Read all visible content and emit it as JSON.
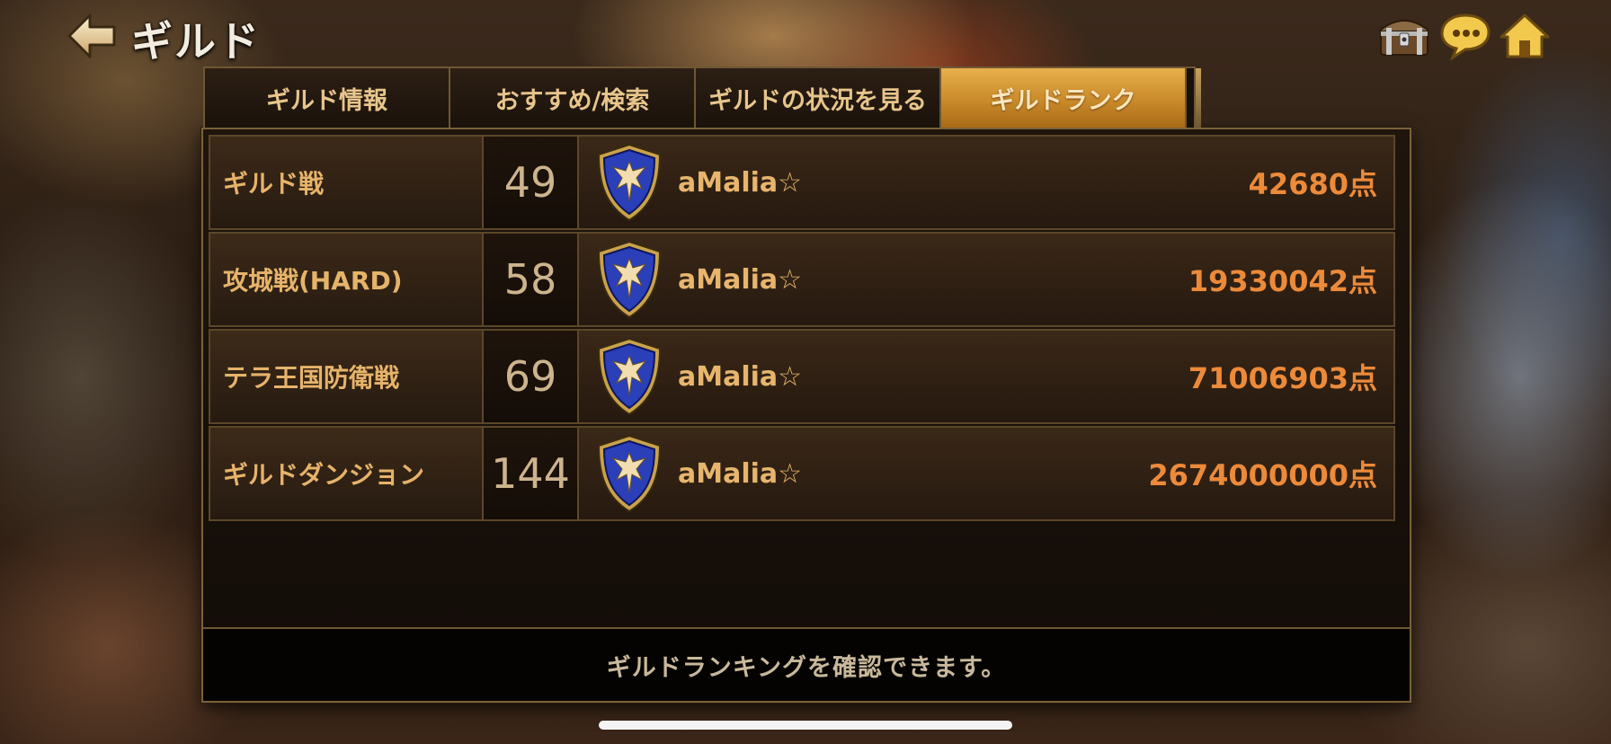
{
  "header": {
    "title": "ギルド"
  },
  "tabs": [
    {
      "label": "ギルド情報",
      "active": false
    },
    {
      "label": "おすすめ/検索",
      "active": false
    },
    {
      "label": "ギルドの状況を見る",
      "active": false
    },
    {
      "label": "ギルドランク",
      "active": true
    }
  ],
  "rankings": [
    {
      "category": "ギルド戦",
      "rank": "49",
      "guild": "aMalia☆",
      "score": "42680点"
    },
    {
      "category": "攻城戦(HARD)",
      "rank": "58",
      "guild": "aMalia☆",
      "score": "19330042点"
    },
    {
      "category": "テラ王国防衛戦",
      "rank": "69",
      "guild": "aMalia☆",
      "score": "71006903点"
    },
    {
      "category": "ギルドダンジョン",
      "rank": "144",
      "guild": "aMalia☆",
      "score": "2674000000点"
    }
  ],
  "info": {
    "message": "ギルドランキングを確認できます。"
  },
  "icons": {
    "back": "back-arrow-icon",
    "chest": "treasure-chest-icon",
    "chat": "chat-bubble-icon",
    "home": "home-icon",
    "emblem": "guild-emblem-icon"
  },
  "colors": {
    "active_tab": "#c98a2a",
    "score": "#ec8a3a",
    "category_text": "#e6b36a",
    "emblem_blue": "#2a3fb8"
  }
}
